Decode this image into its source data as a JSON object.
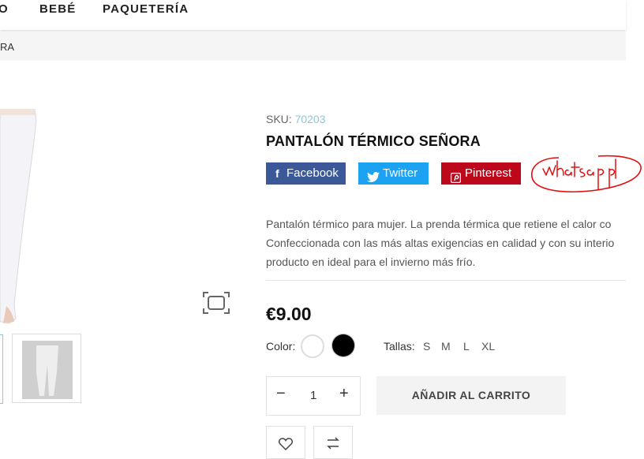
{
  "nav": {
    "items": [
      "O",
      "BEBÉ",
      "PAQUETERÍA"
    ]
  },
  "breadcrumb": {
    "current": "RA"
  },
  "product": {
    "sku_label": "SKU:",
    "sku_value": "70203",
    "title": "PANTALÓN TÉRMICO SEÑORA",
    "share": [
      {
        "label": "Facebook",
        "icon": "facebook-icon",
        "color": "#3b5998"
      },
      {
        "label": "Twitter",
        "icon": "twitter-icon",
        "color": "#1da1f2"
      },
      {
        "label": "Pinterest",
        "icon": "pinterest-icon",
        "color": "#bd081c"
      }
    ],
    "description_lines": [
      "Pantalón térmico para mujer. La prenda térmica que retiene el calor co",
      "Confeccionada con las más altas exigencias en calidad y con su interio",
      "producto en ideal para el invierno más frío."
    ],
    "price": "€9.00",
    "color_label": "Color:",
    "colors": [
      "#ffffff",
      "#000000"
    ],
    "sizes_label": "Tallas:",
    "sizes": [
      "S",
      "M",
      "L",
      "XL"
    ],
    "quantity": "1",
    "add_to_cart": "AÑADIR AL CARRITO"
  },
  "annotation": {
    "handwritten_text": "whatsapp"
  }
}
